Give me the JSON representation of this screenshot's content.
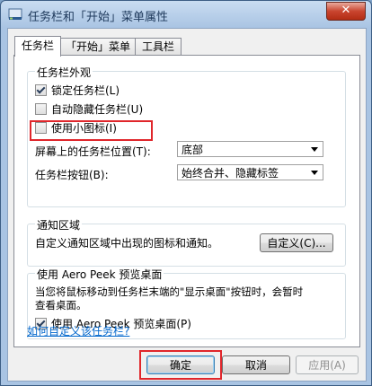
{
  "window": {
    "title": "任务栏和「开始」菜单属性",
    "close_label": "✕"
  },
  "tabs": [
    {
      "label": "任务栏"
    },
    {
      "label": "「开始」菜单"
    },
    {
      "label": "工具栏"
    }
  ],
  "appearance": {
    "legend": "任务栏外观",
    "lock": {
      "label": "锁定任务栏(L)",
      "checked": true
    },
    "autohide": {
      "label": "自动隐藏任务栏(U)",
      "checked": false
    },
    "small_icons": {
      "label": "使用小图标(I)",
      "checked": false
    },
    "location_label": "屏幕上的任务栏位置(T):",
    "location_value": "底部",
    "buttons_label": "任务栏按钮(B):",
    "buttons_value": "始终合并、隐藏标签"
  },
  "notification": {
    "legend": "通知区域",
    "description": "自定义通知区域中出现的图标和通知。",
    "customize_label": "自定义(C)..."
  },
  "aero_peek": {
    "legend": "使用 Aero Peek 预览桌面",
    "description_line1": "当您将鼠标移动到任务栏末端的\"显示桌面\"按钮时，会暂时",
    "description_line2": "查看桌面。",
    "checkbox": {
      "label": "使用 Aero Peek 预览桌面(P)",
      "checked": true
    }
  },
  "help_link": "如何自定义该任务栏?",
  "buttons": {
    "ok": "确定",
    "cancel": "取消",
    "apply": "应用(A)"
  },
  "colors": {
    "highlight": "#e0262b",
    "link": "#0066cc"
  }
}
